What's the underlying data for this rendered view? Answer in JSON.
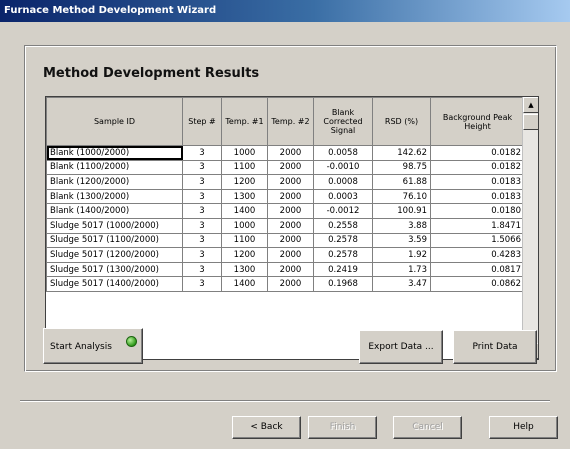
{
  "window": {
    "title": "Furnace Method Development Wizard"
  },
  "panel": {
    "title": "Method Development Results"
  },
  "grid": {
    "columns": [
      "Sample ID",
      "Step #",
      "Temp. #1",
      "Temp. #2",
      "Blank Corrected Signal",
      "RSD (%)",
      "Background Peak Height"
    ],
    "rows": [
      [
        "Blank (1000/2000)",
        "3",
        "1000",
        "2000",
        "0.0058",
        "142.62",
        "0.0182"
      ],
      [
        "Blank (1100/2000)",
        "3",
        "1100",
        "2000",
        "-0.0010",
        "98.75",
        "0.0182"
      ],
      [
        "Blank (1200/2000)",
        "3",
        "1200",
        "2000",
        "0.0008",
        "61.88",
        "0.0183"
      ],
      [
        "Blank (1300/2000)",
        "3",
        "1300",
        "2000",
        "0.0003",
        "76.10",
        "0.0183"
      ],
      [
        "Blank (1400/2000)",
        "3",
        "1400",
        "2000",
        "-0.0012",
        "100.91",
        "0.0180"
      ],
      [
        "Sludge 5017 (1000/2000)",
        "3",
        "1000",
        "2000",
        "0.2558",
        "3.88",
        "1.8471"
      ],
      [
        "Sludge 5017 (1100/2000)",
        "3",
        "1100",
        "2000",
        "0.2578",
        "3.59",
        "1.5066"
      ],
      [
        "Sludge 5017 (1200/2000)",
        "3",
        "1200",
        "2000",
        "0.2578",
        "1.92",
        "0.4283"
      ],
      [
        "Sludge 5017 (1300/2000)",
        "3",
        "1300",
        "2000",
        "0.2419",
        "1.73",
        "0.0817"
      ],
      [
        "Sludge 5017 (1400/2000)",
        "3",
        "1400",
        "2000",
        "0.1968",
        "3.47",
        "0.0862"
      ]
    ]
  },
  "buttons": {
    "start_analysis": "Start Analysis",
    "export_data": "Export Data ...",
    "print_data": "Print Data",
    "back": "< Back",
    "finish": "Finish",
    "cancel": "Cancel",
    "help": "Help"
  },
  "icons": {
    "scroll_up": "scroll-up-arrow",
    "scroll_down": "scroll-down-arrow",
    "start": "green-circle"
  },
  "colors": {
    "title_bar": "#0a246a",
    "dialog": "#d4d0c8",
    "start_icon": "#2f9a1a"
  }
}
